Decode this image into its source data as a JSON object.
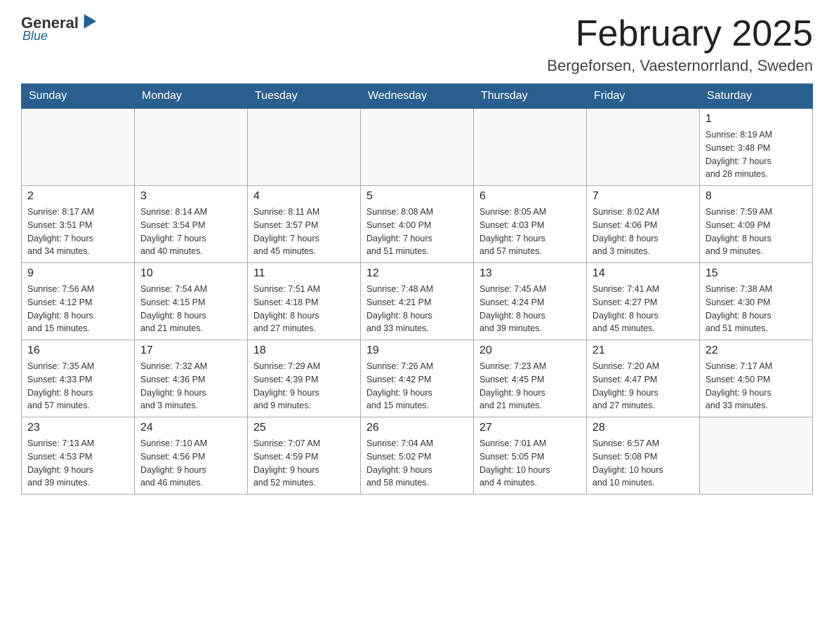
{
  "header": {
    "logo": {
      "general": "General",
      "blue": "Blue"
    },
    "title": "February 2025",
    "location": "Bergeforsen, Vaesternorrland, Sweden"
  },
  "days_of_week": [
    "Sunday",
    "Monday",
    "Tuesday",
    "Wednesday",
    "Thursday",
    "Friday",
    "Saturday"
  ],
  "weeks": [
    {
      "days": [
        {
          "num": "",
          "info": ""
        },
        {
          "num": "",
          "info": ""
        },
        {
          "num": "",
          "info": ""
        },
        {
          "num": "",
          "info": ""
        },
        {
          "num": "",
          "info": ""
        },
        {
          "num": "",
          "info": ""
        },
        {
          "num": "1",
          "info": "Sunrise: 8:19 AM\nSunset: 3:48 PM\nDaylight: 7 hours\nand 28 minutes."
        }
      ]
    },
    {
      "days": [
        {
          "num": "2",
          "info": "Sunrise: 8:17 AM\nSunset: 3:51 PM\nDaylight: 7 hours\nand 34 minutes."
        },
        {
          "num": "3",
          "info": "Sunrise: 8:14 AM\nSunset: 3:54 PM\nDaylight: 7 hours\nand 40 minutes."
        },
        {
          "num": "4",
          "info": "Sunrise: 8:11 AM\nSunset: 3:57 PM\nDaylight: 7 hours\nand 45 minutes."
        },
        {
          "num": "5",
          "info": "Sunrise: 8:08 AM\nSunset: 4:00 PM\nDaylight: 7 hours\nand 51 minutes."
        },
        {
          "num": "6",
          "info": "Sunrise: 8:05 AM\nSunset: 4:03 PM\nDaylight: 7 hours\nand 57 minutes."
        },
        {
          "num": "7",
          "info": "Sunrise: 8:02 AM\nSunset: 4:06 PM\nDaylight: 8 hours\nand 3 minutes."
        },
        {
          "num": "8",
          "info": "Sunrise: 7:59 AM\nSunset: 4:09 PM\nDaylight: 8 hours\nand 9 minutes."
        }
      ]
    },
    {
      "days": [
        {
          "num": "9",
          "info": "Sunrise: 7:56 AM\nSunset: 4:12 PM\nDaylight: 8 hours\nand 15 minutes."
        },
        {
          "num": "10",
          "info": "Sunrise: 7:54 AM\nSunset: 4:15 PM\nDaylight: 8 hours\nand 21 minutes."
        },
        {
          "num": "11",
          "info": "Sunrise: 7:51 AM\nSunset: 4:18 PM\nDaylight: 8 hours\nand 27 minutes."
        },
        {
          "num": "12",
          "info": "Sunrise: 7:48 AM\nSunset: 4:21 PM\nDaylight: 8 hours\nand 33 minutes."
        },
        {
          "num": "13",
          "info": "Sunrise: 7:45 AM\nSunset: 4:24 PM\nDaylight: 8 hours\nand 39 minutes."
        },
        {
          "num": "14",
          "info": "Sunrise: 7:41 AM\nSunset: 4:27 PM\nDaylight: 8 hours\nand 45 minutes."
        },
        {
          "num": "15",
          "info": "Sunrise: 7:38 AM\nSunset: 4:30 PM\nDaylight: 8 hours\nand 51 minutes."
        }
      ]
    },
    {
      "days": [
        {
          "num": "16",
          "info": "Sunrise: 7:35 AM\nSunset: 4:33 PM\nDaylight: 8 hours\nand 57 minutes."
        },
        {
          "num": "17",
          "info": "Sunrise: 7:32 AM\nSunset: 4:36 PM\nDaylight: 9 hours\nand 3 minutes."
        },
        {
          "num": "18",
          "info": "Sunrise: 7:29 AM\nSunset: 4:39 PM\nDaylight: 9 hours\nand 9 minutes."
        },
        {
          "num": "19",
          "info": "Sunrise: 7:26 AM\nSunset: 4:42 PM\nDaylight: 9 hours\nand 15 minutes."
        },
        {
          "num": "20",
          "info": "Sunrise: 7:23 AM\nSunset: 4:45 PM\nDaylight: 9 hours\nand 21 minutes."
        },
        {
          "num": "21",
          "info": "Sunrise: 7:20 AM\nSunset: 4:47 PM\nDaylight: 9 hours\nand 27 minutes."
        },
        {
          "num": "22",
          "info": "Sunrise: 7:17 AM\nSunset: 4:50 PM\nDaylight: 9 hours\nand 33 minutes."
        }
      ]
    },
    {
      "days": [
        {
          "num": "23",
          "info": "Sunrise: 7:13 AM\nSunset: 4:53 PM\nDaylight: 9 hours\nand 39 minutes."
        },
        {
          "num": "24",
          "info": "Sunrise: 7:10 AM\nSunset: 4:56 PM\nDaylight: 9 hours\nand 46 minutes."
        },
        {
          "num": "25",
          "info": "Sunrise: 7:07 AM\nSunset: 4:59 PM\nDaylight: 9 hours\nand 52 minutes."
        },
        {
          "num": "26",
          "info": "Sunrise: 7:04 AM\nSunset: 5:02 PM\nDaylight: 9 hours\nand 58 minutes."
        },
        {
          "num": "27",
          "info": "Sunrise: 7:01 AM\nSunset: 5:05 PM\nDaylight: 10 hours\nand 4 minutes."
        },
        {
          "num": "28",
          "info": "Sunrise: 6:57 AM\nSunset: 5:08 PM\nDaylight: 10 hours\nand 10 minutes."
        },
        {
          "num": "",
          "info": ""
        }
      ]
    }
  ]
}
